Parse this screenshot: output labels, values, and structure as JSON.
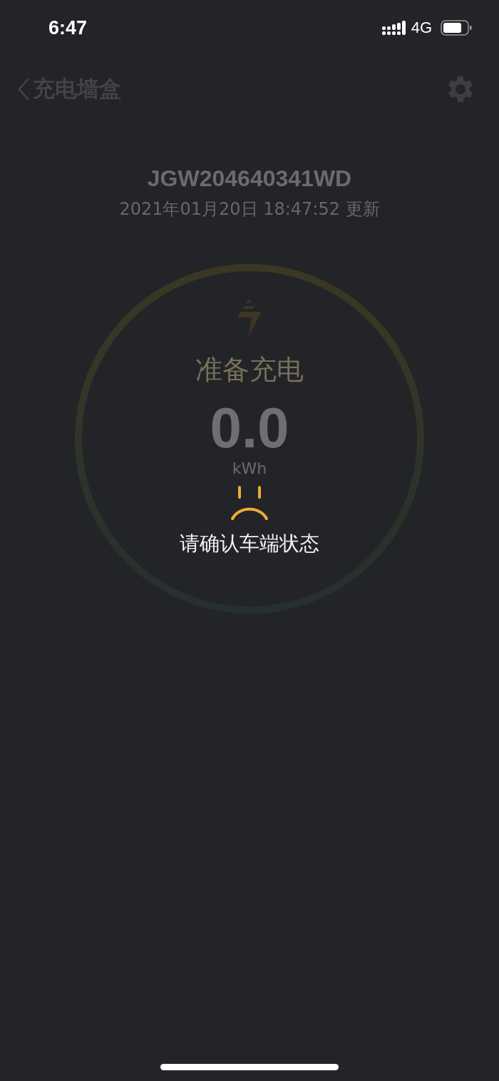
{
  "status_bar": {
    "time": "6:47",
    "network": "4G"
  },
  "nav": {
    "title": "充电墙盒"
  },
  "device": {
    "serial": "JGW204640341WD",
    "updated": "2021年01月20日 18:47:52 更新"
  },
  "charger": {
    "status": "准备充电",
    "reading": "0.0",
    "unit": "kWh"
  },
  "alert": {
    "message": "请确认车端状态"
  }
}
